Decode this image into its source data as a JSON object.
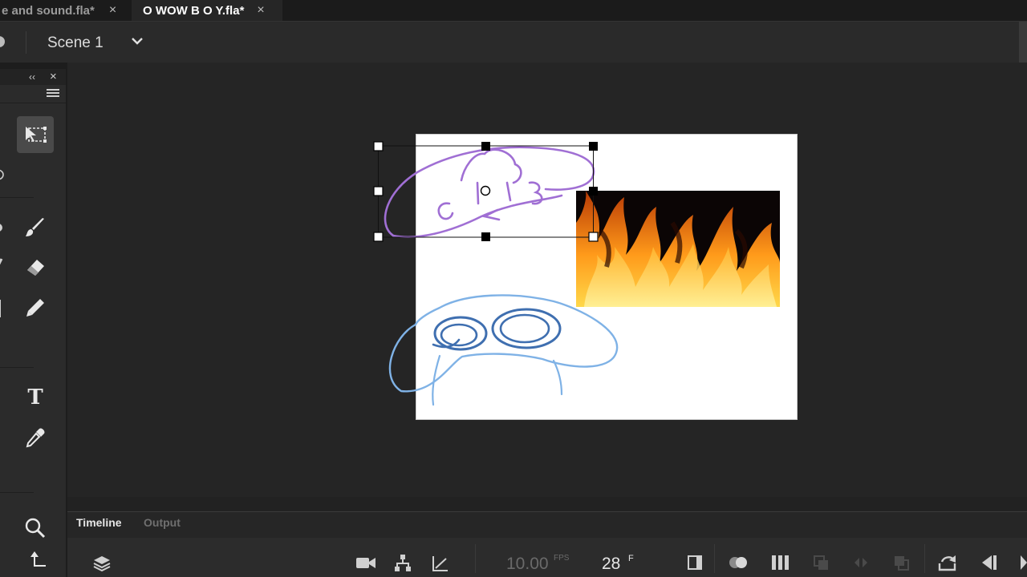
{
  "tabs": [
    {
      "label": "e and sound.fla*",
      "close": "×"
    },
    {
      "label": "O WOW B O Y.fla*",
      "close": "×"
    }
  ],
  "scene": {
    "name": "Scene 1",
    "dropdown_icon": "chevron-down-icon"
  },
  "tools_panel": {
    "collapse_label": "‹‹",
    "close_label": "×",
    "tools": [
      "free-transform-tool",
      "lasso-tool",
      "brush-tool",
      "eraser-tool",
      "pencil-tool",
      "text-tool",
      "eyedropper-tool",
      "zoom-tool",
      "hand-tool"
    ],
    "text_tool_glyph": "T"
  },
  "timeline": {
    "tabs": [
      "Timeline",
      "Output"
    ],
    "fps_value": "10.00",
    "fps_unit": "FPS",
    "frame_value": "28",
    "frame_unit": "F"
  },
  "colors": {
    "stage": "#ffffff",
    "selection_handle": "#000000",
    "purple_stroke": "#a06fd4",
    "blue_stroke": "#7fb2e6",
    "dark_blue_stroke": "#3f6fb0"
  }
}
